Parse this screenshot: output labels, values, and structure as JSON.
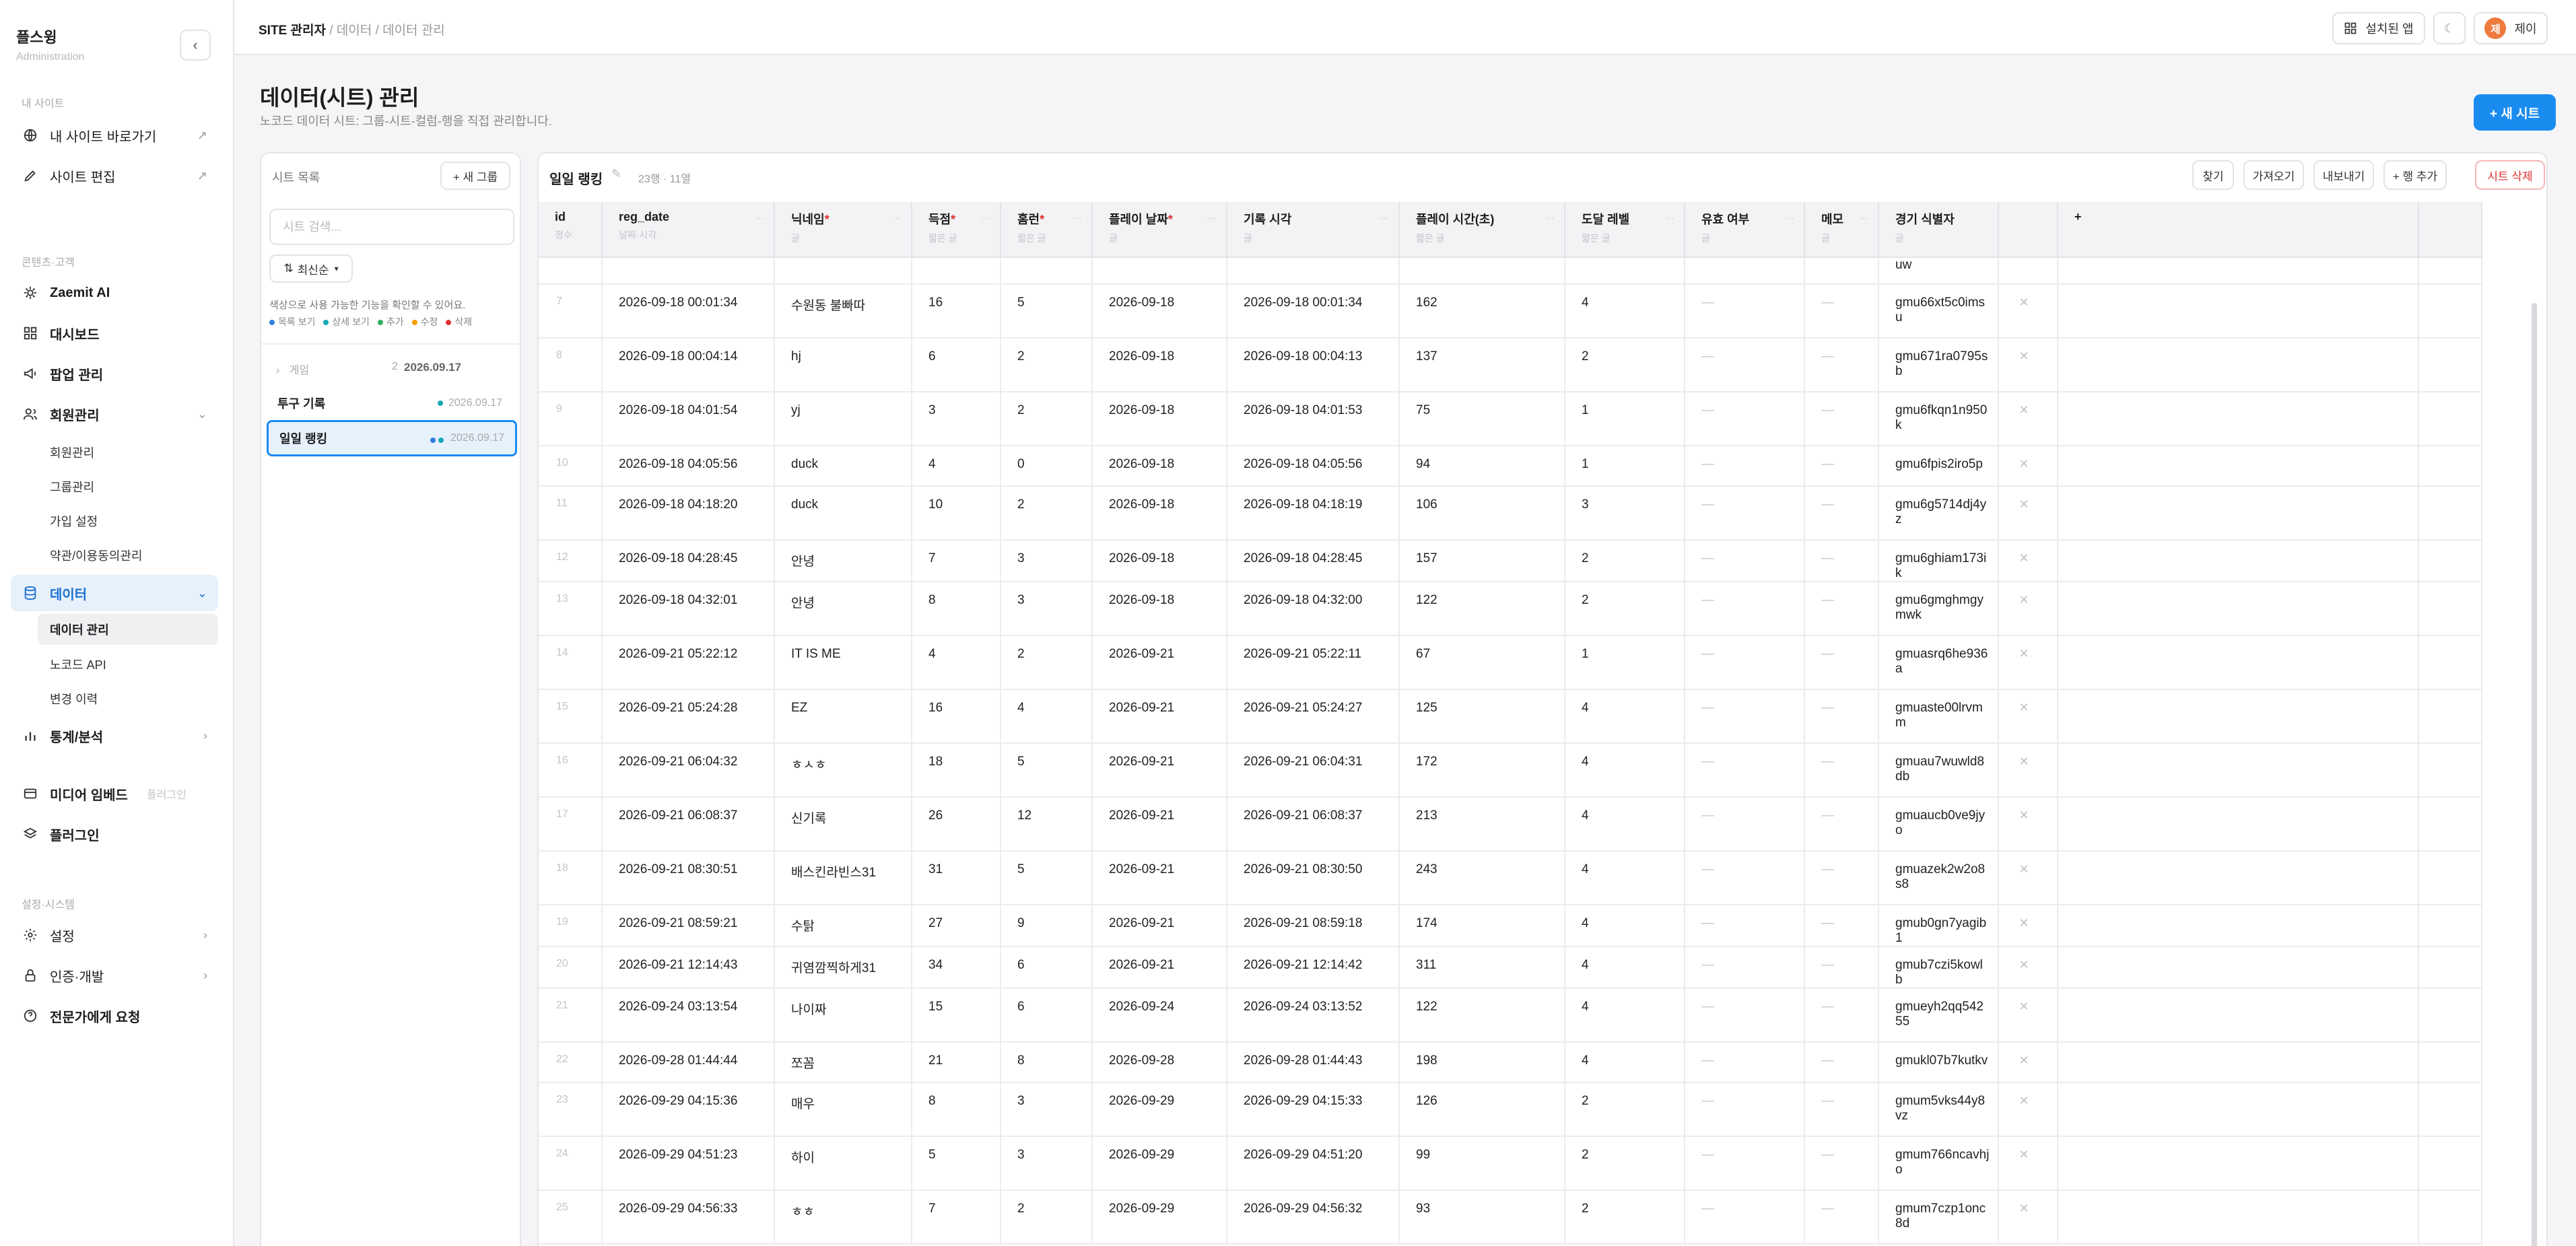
{
  "sidebar": {
    "brand_title": "플스윙",
    "brand_sub": "Administration",
    "sec_site": "내 사이트",
    "site_links": [
      {
        "label": "내 사이트 바로가기",
        "icon": "globe-icon"
      },
      {
        "label": "사이트 편집",
        "icon": "pencil-icon"
      }
    ],
    "sec_contents": "콘텐츠·고객",
    "nav": {
      "zaemit": "Zaemit AI",
      "dashboard": "대시보드",
      "popup": "팝업 관리",
      "members": "회원관리",
      "data": "데이터",
      "stats": "통계/분석",
      "media": "미디어 임베드",
      "media_tag": "플러그인",
      "plugin": "플러그인",
      "settings": "설정",
      "auth": "인증·개발",
      "expert": "전문가에게 요청"
    },
    "member_subs": [
      "회원관리",
      "그룹관리",
      "가입 설정",
      "약관/이용동의관리"
    ],
    "data_subs": [
      "데이터 관리",
      "노코드 API",
      "변경 이력"
    ],
    "sec_system": "설정·시스템"
  },
  "header": {
    "crumb_root": "SITE 관리자",
    "crumb_1": "데이터",
    "crumb_2": "데이터 관리",
    "apps_label": "설치된 앱",
    "user_initial": "제",
    "user_name": "제이"
  },
  "page": {
    "title": "데이터(시트) 관리",
    "subtitle": "노코드 데이터 시트: 그룹-시트-컬럼-행을 직접 관리합니다.",
    "new_sheet": "+ 새 시트"
  },
  "sheet_list": {
    "title": "시트 목록",
    "new_group": "+ 새 그룹",
    "search_placeholder": "시트 검색...",
    "sort_label": "최신순",
    "hint": "색상으로 사용 가능한 기능을 확인할 수 있어요.",
    "legend": [
      {
        "label": "목록 보기",
        "color": "#2f7de1"
      },
      {
        "label": "상세 보기",
        "color": "#16a9b5"
      },
      {
        "label": "추가",
        "color": "#2fae61"
      },
      {
        "label": "수정",
        "color": "#f59f00"
      },
      {
        "label": "삭제",
        "color": "#e03131"
      }
    ],
    "group_name": "게임",
    "group_count": "2",
    "group_date": "2026.09.17",
    "items": [
      {
        "name": "투구 기록",
        "date": "2026.09.17"
      },
      {
        "name": "일일 랭킹",
        "date": "2026.09.17"
      }
    ]
  },
  "sheet": {
    "name": "일일 랭킹",
    "meta": "23행 · 11열",
    "actions": {
      "find": "찾기",
      "import": "가져오기",
      "export": "내보내기",
      "add_row": "+ 행 추가",
      "delete": "시트 삭제"
    },
    "add_col": "+",
    "columns": [
      {
        "name": "id",
        "type": "정수",
        "req": false
      },
      {
        "name": "reg_date",
        "type": "날짜·시각",
        "req": false
      },
      {
        "name": "닉네임",
        "type": "글",
        "req": true
      },
      {
        "name": "득점",
        "type": "짧은 글",
        "req": true
      },
      {
        "name": "홈런",
        "type": "짧은 글",
        "req": true
      },
      {
        "name": "플레이 날짜",
        "type": "글",
        "req": true
      },
      {
        "name": "기록 시각",
        "type": "글",
        "req": false
      },
      {
        "name": "플레이 시간(초)",
        "type": "짧은 글",
        "req": false
      },
      {
        "name": "도달 레벨",
        "type": "짧은 글",
        "req": false
      },
      {
        "name": "유효 여부",
        "type": "글",
        "req": false
      },
      {
        "name": "메모",
        "type": "글",
        "req": false
      },
      {
        "name": "경기 식별자",
        "type": "글",
        "req": false
      }
    ],
    "partial_row_tail": "uw",
    "empty_mark": "—",
    "delete_mark": "✕",
    "rows": [
      {
        "id": "7",
        "reg": "2026-09-18 00:01:34",
        "nick": "수원동 불빠따",
        "score": "16",
        "hr": "5",
        "pdate": "2026-09-18",
        "rtime": "2026-09-18 00:01:34",
        "secs": "162",
        "level": "4",
        "gid": "gmu66xt5c0imsu"
      },
      {
        "id": "8",
        "reg": "2026-09-18 00:04:14",
        "nick": "hj",
        "score": "6",
        "hr": "2",
        "pdate": "2026-09-18",
        "rtime": "2026-09-18 00:04:13",
        "secs": "137",
        "level": "2",
        "gid": "gmu671ra0795sb"
      },
      {
        "id": "9",
        "reg": "2026-09-18 04:01:54",
        "nick": "yj",
        "score": "3",
        "hr": "2",
        "pdate": "2026-09-18",
        "rtime": "2026-09-18 04:01:53",
        "secs": "75",
        "level": "1",
        "gid": "gmu6fkqn1n950k"
      },
      {
        "id": "10",
        "reg": "2026-09-18 04:05:56",
        "nick": "duck",
        "score": "4",
        "hr": "0",
        "pdate": "2026-09-18",
        "rtime": "2026-09-18 04:05:56",
        "secs": "94",
        "level": "1",
        "gid": "gmu6fpis2iro5p"
      },
      {
        "id": "11",
        "reg": "2026-09-18 04:18:20",
        "nick": "duck",
        "score": "10",
        "hr": "2",
        "pdate": "2026-09-18",
        "rtime": "2026-09-18 04:18:19",
        "secs": "106",
        "level": "3",
        "gid": "gmu6g5714dj4yz"
      },
      {
        "id": "12",
        "reg": "2026-09-18 04:28:45",
        "nick": "안녕",
        "score": "7",
        "hr": "3",
        "pdate": "2026-09-18",
        "rtime": "2026-09-18 04:28:45",
        "secs": "157",
        "level": "2",
        "gid": "gmu6ghiam173ik"
      },
      {
        "id": "13",
        "reg": "2026-09-18 04:32:01",
        "nick": "안녕",
        "score": "8",
        "hr": "3",
        "pdate": "2026-09-18",
        "rtime": "2026-09-18 04:32:00",
        "secs": "122",
        "level": "2",
        "gid": "gmu6gmghmgymwk"
      },
      {
        "id": "14",
        "reg": "2026-09-21 05:22:12",
        "nick": "IT IS ME",
        "score": "4",
        "hr": "2",
        "pdate": "2026-09-21",
        "rtime": "2026-09-21 05:22:11",
        "secs": "67",
        "level": "1",
        "gid": "gmuasrq6he936a"
      },
      {
        "id": "15",
        "reg": "2026-09-21 05:24:28",
        "nick": "EZ",
        "score": "16",
        "hr": "4",
        "pdate": "2026-09-21",
        "rtime": "2026-09-21 05:24:27",
        "secs": "125",
        "level": "4",
        "gid": "gmuaste00lrvmm"
      },
      {
        "id": "16",
        "reg": "2026-09-21 06:04:32",
        "nick": "ㅎㅅㅎ",
        "score": "18",
        "hr": "5",
        "pdate": "2026-09-21",
        "rtime": "2026-09-21 06:04:31",
        "secs": "172",
        "level": "4",
        "gid": "gmuau7wuwld8db"
      },
      {
        "id": "17",
        "reg": "2026-09-21 06:08:37",
        "nick": "신기록",
        "score": "26",
        "hr": "12",
        "pdate": "2026-09-21",
        "rtime": "2026-09-21 06:08:37",
        "secs": "213",
        "level": "4",
        "gid": "gmuaucb0ve9jyo"
      },
      {
        "id": "18",
        "reg": "2026-09-21 08:30:51",
        "nick": "배스킨라빈스31",
        "score": "31",
        "hr": "5",
        "pdate": "2026-09-21",
        "rtime": "2026-09-21 08:30:50",
        "secs": "243",
        "level": "4",
        "gid": "gmuazek2w2o8s8"
      },
      {
        "id": "19",
        "reg": "2026-09-21 08:59:21",
        "nick": "수탉",
        "score": "27",
        "hr": "9",
        "pdate": "2026-09-21",
        "rtime": "2026-09-21 08:59:18",
        "secs": "174",
        "level": "4",
        "gid": "gmub0gn7yagib1"
      },
      {
        "id": "20",
        "reg": "2026-09-21 12:14:43",
        "nick": "귀염깜찍하게31",
        "score": "34",
        "hr": "6",
        "pdate": "2026-09-21",
        "rtime": "2026-09-21 12:14:42",
        "secs": "311",
        "level": "4",
        "gid": "gmub7czi5kowlb"
      },
      {
        "id": "21",
        "reg": "2026-09-24 03:13:54",
        "nick": "나이짜",
        "score": "15",
        "hr": "6",
        "pdate": "2026-09-24",
        "rtime": "2026-09-24 03:13:52",
        "secs": "122",
        "level": "4",
        "gid": "gmueyh2qq54255"
      },
      {
        "id": "22",
        "reg": "2026-09-28 01:44:44",
        "nick": "쪼꼼",
        "score": "21",
        "hr": "8",
        "pdate": "2026-09-28",
        "rtime": "2026-09-28 01:44:43",
        "secs": "198",
        "level": "4",
        "gid": "gmukl07b7kutkv"
      },
      {
        "id": "23",
        "reg": "2026-09-29 04:15:36",
        "nick": "매우",
        "score": "8",
        "hr": "3",
        "pdate": "2026-09-29",
        "rtime": "2026-09-29 04:15:33",
        "secs": "126",
        "level": "2",
        "gid": "gmum5vks44y8vz"
      },
      {
        "id": "24",
        "reg": "2026-09-29 04:51:23",
        "nick": "하이",
        "score": "5",
        "hr": "3",
        "pdate": "2026-09-29",
        "rtime": "2026-09-29 04:51:20",
        "secs": "99",
        "level": "2",
        "gid": "gmum766ncavhjo"
      },
      {
        "id": "25",
        "reg": "2026-09-29 04:56:33",
        "nick": "ㅎㅎ",
        "score": "7",
        "hr": "2",
        "pdate": "2026-09-29",
        "rtime": "2026-09-29 04:56:32",
        "secs": "93",
        "level": "2",
        "gid": "gmum7czp1onc8d"
      }
    ]
  }
}
